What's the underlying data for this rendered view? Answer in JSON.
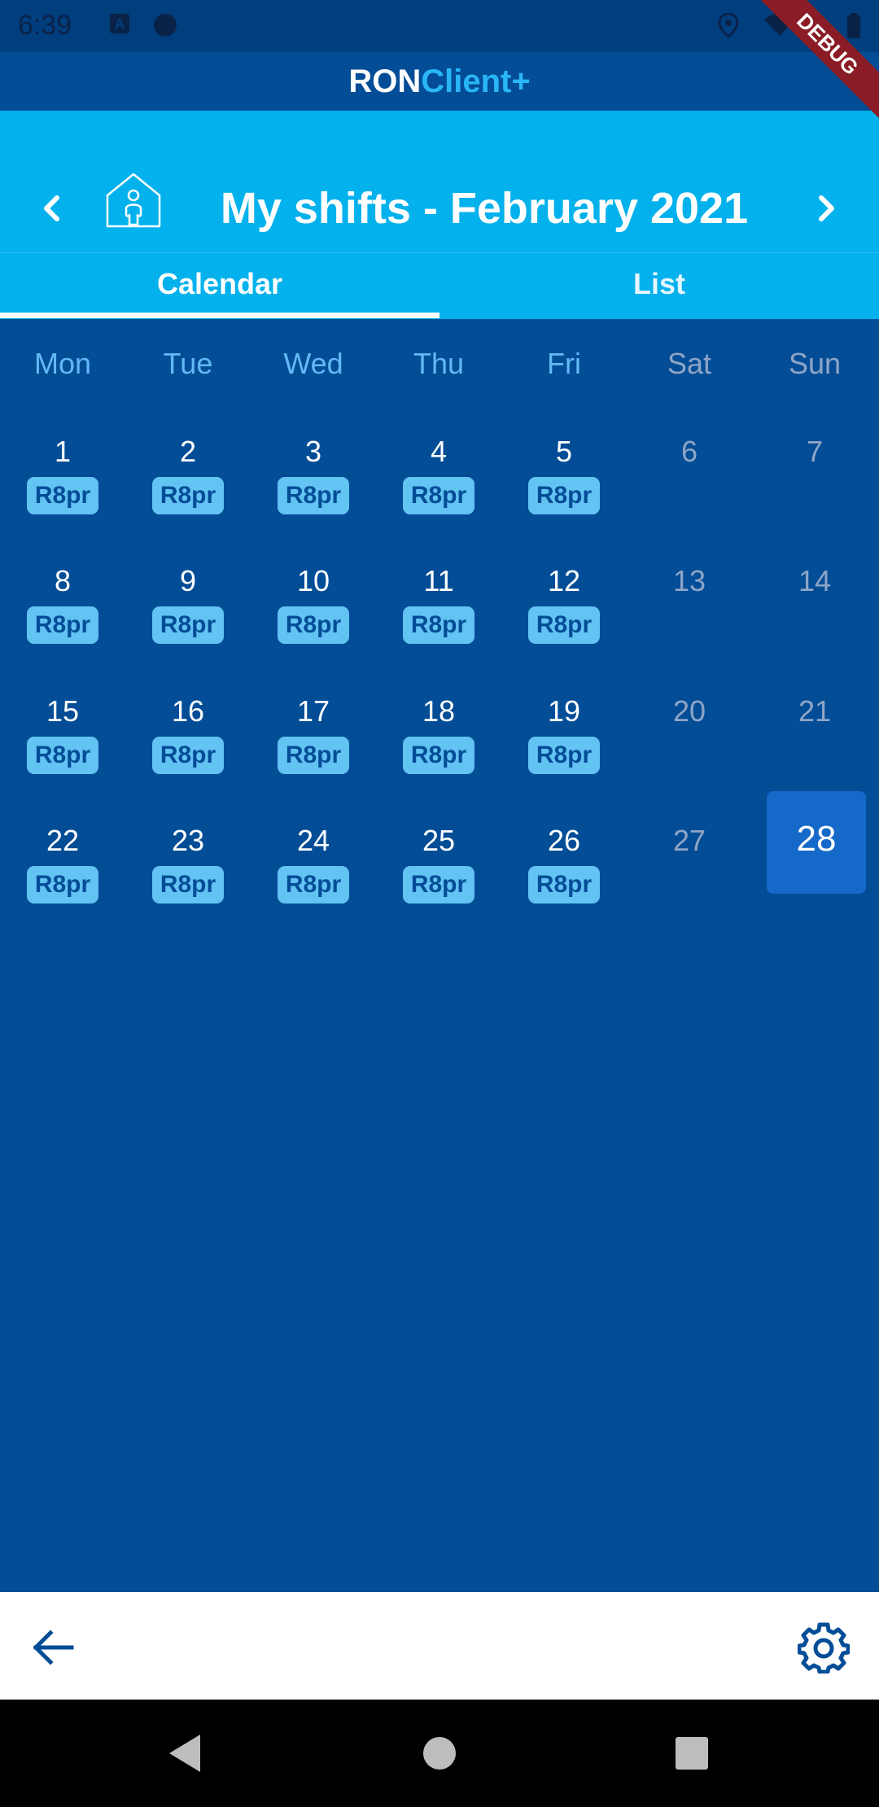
{
  "status_bar": {
    "time": "6:39"
  },
  "app": {
    "title_part1": "RON",
    "title_part2": "Client+"
  },
  "header": {
    "title": "My shifts - February 2021"
  },
  "tabs": [
    {
      "label": "Calendar",
      "active": true
    },
    {
      "label": "List",
      "active": false
    }
  ],
  "weekdays": [
    "Mon",
    "Tue",
    "Wed",
    "Thu",
    "Fri",
    "Sat",
    "Sun"
  ],
  "calendar": {
    "weeks": [
      [
        {
          "day": "1",
          "shift": "R8pr"
        },
        {
          "day": "2",
          "shift": "R8pr"
        },
        {
          "day": "3",
          "shift": "R8pr"
        },
        {
          "day": "4",
          "shift": "R8pr"
        },
        {
          "day": "5",
          "shift": "R8pr"
        },
        {
          "day": "6"
        },
        {
          "day": "7"
        }
      ],
      [
        {
          "day": "8",
          "shift": "R8pr"
        },
        {
          "day": "9",
          "shift": "R8pr"
        },
        {
          "day": "10",
          "shift": "R8pr"
        },
        {
          "day": "11",
          "shift": "R8pr"
        },
        {
          "day": "12",
          "shift": "R8pr"
        },
        {
          "day": "13"
        },
        {
          "day": "14"
        }
      ],
      [
        {
          "day": "15",
          "shift": "R8pr"
        },
        {
          "day": "16",
          "shift": "R8pr"
        },
        {
          "day": "17",
          "shift": "R8pr"
        },
        {
          "day": "18",
          "shift": "R8pr"
        },
        {
          "day": "19",
          "shift": "R8pr"
        },
        {
          "day": "20"
        },
        {
          "day": "21"
        }
      ],
      [
        {
          "day": "22",
          "shift": "R8pr"
        },
        {
          "day": "23",
          "shift": "R8pr"
        },
        {
          "day": "24",
          "shift": "R8pr"
        },
        {
          "day": "25",
          "shift": "R8pr"
        },
        {
          "day": "26",
          "shift": "R8pr"
        },
        {
          "day": "27"
        },
        {
          "day": "28",
          "today": true
        }
      ]
    ]
  },
  "debug_banner": "DEBUG",
  "colors": {
    "background": "#034d97",
    "header": "#03b1ec",
    "shift_badge": "#63c3f2",
    "today": "#1469c9",
    "weekday_label": "#62b8f4",
    "weekend_label": "#8fa5c6"
  },
  "icons": {
    "prev": "chevron-left-icon",
    "next": "chevron-right-icon",
    "home": "house-person-icon",
    "back": "arrow-left-icon",
    "settings": "gear-icon"
  }
}
